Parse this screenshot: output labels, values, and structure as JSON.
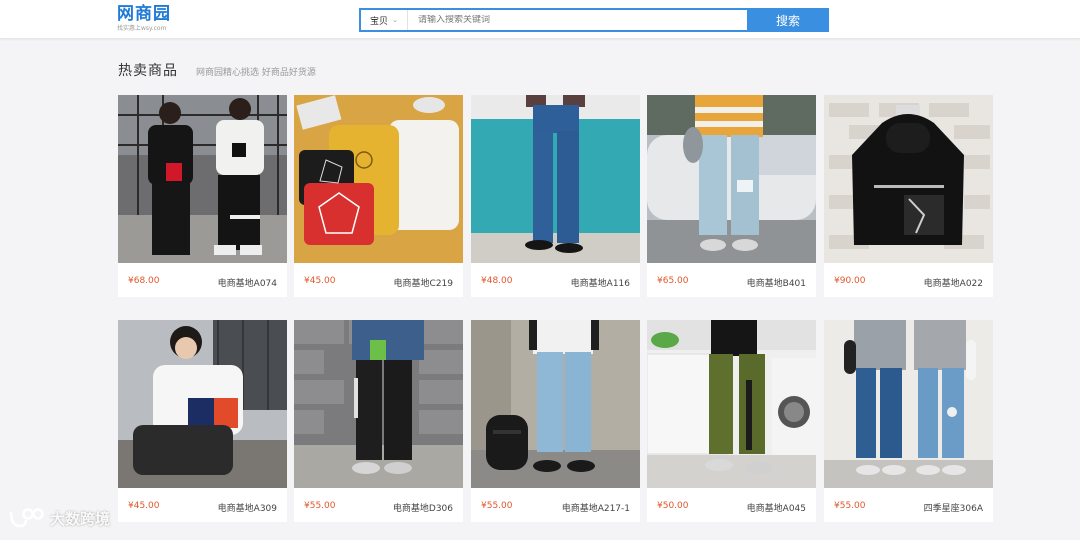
{
  "header": {
    "logo_text": "网商园",
    "logo_sub": "找实惠上wsy.com",
    "search": {
      "category": "宝贝",
      "placeholder": "请输入搜索关键词",
      "button_label": "搜索"
    }
  },
  "section": {
    "title": "热卖商品",
    "subtitle": "网商园精心挑选 好商品好货源"
  },
  "products": [
    {
      "price": "¥68.00",
      "code": "电商基地A074",
      "image": "black-white-outfits-photo"
    },
    {
      "price": "¥45.00",
      "code": "电商基地C219",
      "image": "sweatshirts-flatlay-photo"
    },
    {
      "price": "¥48.00",
      "code": "电商基地A116",
      "image": "blue-jeans-teal-wall-photo"
    },
    {
      "price": "¥65.00",
      "code": "电商基地B401",
      "image": "ripped-jeans-car-photo"
    },
    {
      "price": "¥90.00",
      "code": "电商基地A022",
      "image": "black-hoodie-brick-wall-photo"
    },
    {
      "price": "¥45.00",
      "code": "电商基地A309",
      "image": "white-sweatshirt-model-photo"
    },
    {
      "price": "¥55.00",
      "code": "电商基地D306",
      "image": "black-joggers-photo"
    },
    {
      "price": "¥55.00",
      "code": "电商基地A217-1",
      "image": "light-jeans-backpack-photo"
    },
    {
      "price": "¥50.00",
      "code": "电商基地A045",
      "image": "olive-cargo-pants-photo"
    },
    {
      "price": "¥55.00",
      "code": "四季星座306A",
      "image": "couple-jeans-photo"
    }
  ],
  "watermark": {
    "text": "大数跨境",
    "icon": "brand-logo-icon"
  },
  "colors": {
    "accent": "#3b8fe0",
    "price": "#e1572c",
    "logo": "#1f7ad8",
    "background": "#f4f4f6"
  }
}
